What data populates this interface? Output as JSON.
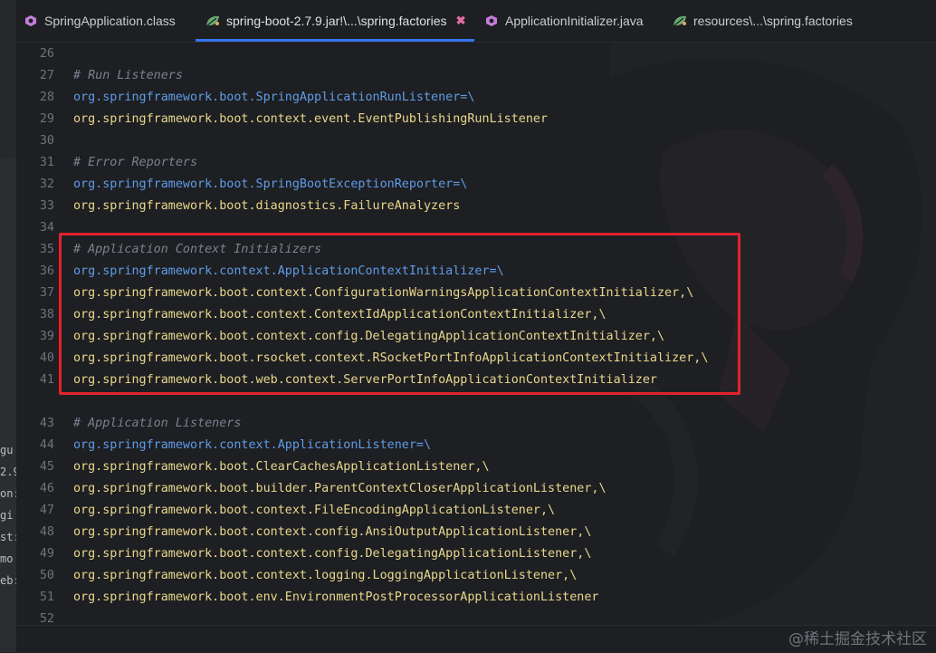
{
  "tabs": [
    {
      "label": "SpringApplication.class",
      "icon": "class-file-icon",
      "active": false
    },
    {
      "label": "spring-boot-2.7.9.jar!\\...\\spring.factories",
      "icon": "spring-leaf-icon",
      "active": true,
      "close": "✖"
    },
    {
      "label": "ApplicationInitializer.java",
      "icon": "class-file-icon",
      "active": false
    },
    {
      "label": "resources\\...\\spring.factories",
      "icon": "spring-leaf-icon",
      "active": false
    }
  ],
  "left_fragments": [
    "gu",
    "2.9",
    "on:",
    "gi",
    "st:",
    "mo",
    "eb:"
  ],
  "lines": [
    {
      "n": "26",
      "kind": "blank",
      "text": ""
    },
    {
      "n": "27",
      "kind": "comment",
      "text": "# Run Listeners"
    },
    {
      "n": "28",
      "kind": "key",
      "text": "org.springframework.boot.SpringApplicationRunListener=\\"
    },
    {
      "n": "29",
      "kind": "value",
      "text": "org.springframework.boot.context.event.EventPublishingRunListener"
    },
    {
      "n": "30",
      "kind": "blank",
      "text": ""
    },
    {
      "n": "31",
      "kind": "comment",
      "text": "# Error Reporters"
    },
    {
      "n": "32",
      "kind": "key",
      "text": "org.springframework.boot.SpringBootExceptionReporter=\\"
    },
    {
      "n": "33",
      "kind": "value",
      "text": "org.springframework.boot.diagnostics.FailureAnalyzers"
    },
    {
      "n": "34",
      "kind": "blank",
      "text": ""
    },
    {
      "n": "35",
      "kind": "comment",
      "text": "# Application Context Initializers"
    },
    {
      "n": "36",
      "kind": "key",
      "text": "org.springframework.context.ApplicationContextInitializer=\\"
    },
    {
      "n": "37",
      "kind": "value",
      "text": "org.springframework.boot.context.ConfigurationWarningsApplicationContextInitializer,\\"
    },
    {
      "n": "38",
      "kind": "value",
      "text": "org.springframework.boot.context.ContextIdApplicationContextInitializer,\\"
    },
    {
      "n": "39",
      "kind": "value",
      "text": "org.springframework.boot.context.config.DelegatingApplicationContextInitializer,\\"
    },
    {
      "n": "40",
      "kind": "value",
      "text": "org.springframework.boot.rsocket.context.RSocketPortInfoApplicationContextInitializer,\\"
    },
    {
      "n": "41",
      "kind": "value",
      "text": "org.springframework.boot.web.context.ServerPortInfoApplicationContextInitializer"
    },
    {
      "n": "",
      "kind": "blank",
      "text": ""
    },
    {
      "n": "43",
      "kind": "comment",
      "text": "# Application Listeners"
    },
    {
      "n": "44",
      "kind": "key",
      "text": "org.springframework.context.ApplicationListener=\\"
    },
    {
      "n": "45",
      "kind": "value",
      "text": "org.springframework.boot.ClearCachesApplicationListener,\\"
    },
    {
      "n": "46",
      "kind": "value",
      "text": "org.springframework.boot.builder.ParentContextCloserApplicationListener,\\"
    },
    {
      "n": "47",
      "kind": "value",
      "text": "org.springframework.boot.context.FileEncodingApplicationListener,\\"
    },
    {
      "n": "48",
      "kind": "value",
      "text": "org.springframework.boot.context.config.AnsiOutputApplicationListener,\\"
    },
    {
      "n": "49",
      "kind": "value",
      "text": "org.springframework.boot.context.config.DelegatingApplicationListener,\\"
    },
    {
      "n": "50",
      "kind": "value",
      "text": "org.springframework.boot.context.logging.LoggingApplicationListener,\\"
    },
    {
      "n": "51",
      "kind": "value",
      "text": "org.springframework.boot.env.EnvironmentPostProcessorApplicationListener"
    },
    {
      "n": "52",
      "kind": "blank",
      "text": ""
    }
  ],
  "watermark": "@稀土掘金技术社区",
  "colors": {
    "background": "#1e1f22",
    "key": "#5e9ce8",
    "value": "#e8d78d",
    "comment": "#7a8290",
    "highlight_box": "#e1232e",
    "active_tab_underline": "#3574f0"
  }
}
